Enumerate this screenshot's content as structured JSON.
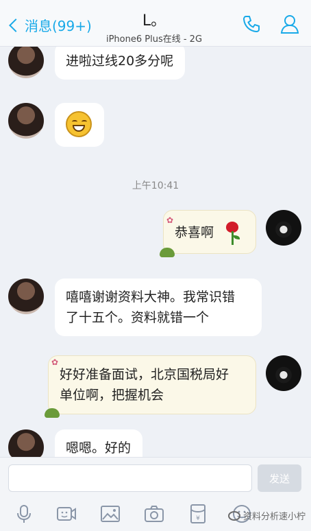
{
  "header": {
    "back_label": "消息(99+)",
    "title": "L。",
    "subtitle": "iPhone6 Plus在线 - 2G"
  },
  "messages": [
    {
      "side": "left",
      "text": "进啦过线20多分呢"
    },
    {
      "side": "left",
      "emoji": "grinning-face-emoji"
    },
    {
      "timestamp": "上午10:41"
    },
    {
      "side": "right",
      "text": "恭喜啊",
      "emoji": "rose-emoji"
    },
    {
      "side": "left",
      "lines": [
        "嘻嘻谢谢资料大神。我常识错",
        "了十五个。资料就错一个"
      ]
    },
    {
      "side": "right",
      "lines": [
        "好好准备面试，北京国税局好",
        "单位啊，把握机会"
      ]
    },
    {
      "side": "left",
      "text": "嗯嗯。好的"
    }
  ],
  "input": {
    "send_label": "发送"
  },
  "watermark": "资料分析速小柠",
  "colors": {
    "accent": "#18a9e8",
    "background": "#eef1f6",
    "bubble_left": "#ffffff",
    "bubble_right": "#fbf8e8"
  }
}
